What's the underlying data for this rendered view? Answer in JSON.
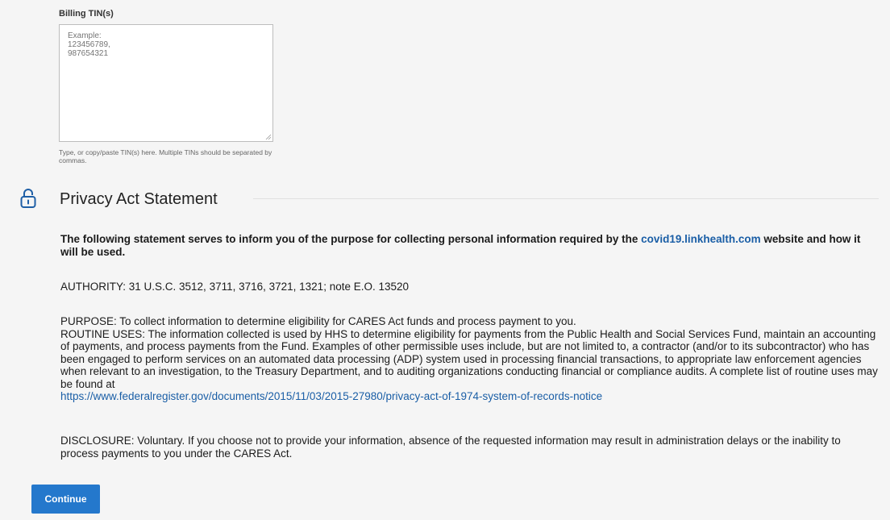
{
  "tin_field": {
    "label": "Billing TIN(s)",
    "placeholder": "Example:\n123456789,\n987654321",
    "value": "",
    "helper": "Type, or copy/paste TIN(s) here. Multiple TINs should be separated by commas."
  },
  "privacy": {
    "icon": "lock-icon",
    "title": "Privacy Act Statement",
    "intro_text": "The following statement serves to inform you of the purpose for collecting personal information required by the",
    "intro_link": "covid19.linkhealth.com",
    "intro_tail": "website and how it will be used.",
    "authority": "AUTHORITY: 31 U.S.C. 3512, 3711, 3716, 3721, 1321; note E.O. 13520",
    "purpose": "PURPOSE: To collect information to determine eligibility for CARES Act funds and process payment to you.",
    "routine_uses": "ROUTINE USES: The information collected is used by HHS to determine eligibility for payments from the Public Health and Social Services Fund, maintain an accounting of payments, and process payments from the Fund. Examples of other permissible uses include, but are not limited to, a contractor (and/or to its subcontractor) who has been engaged to perform services on an automated data processing (ADP) system used in processing financial transactions, to appropriate law enforcement agencies when relevant to an investigation, to the Treasury Department, and to auditing organizations conducting financial or compliance audits. A complete list of routine uses may be found at",
    "routine_link": "https://www.federalregister.gov/documents/2015/11/03/2015-27980/privacy-act-of-1974-system-of-records-notice",
    "disclosure": "DISCLOSURE: Voluntary. If you choose not to provide your information, absence of the requested information may result in administration delays or the inability to process payments to you under the CARES Act."
  },
  "actions": {
    "continue_label": "Continue"
  },
  "colors": {
    "primary": "#2478cc",
    "link": "#1a5ea6",
    "background": "#f5f5f5"
  }
}
